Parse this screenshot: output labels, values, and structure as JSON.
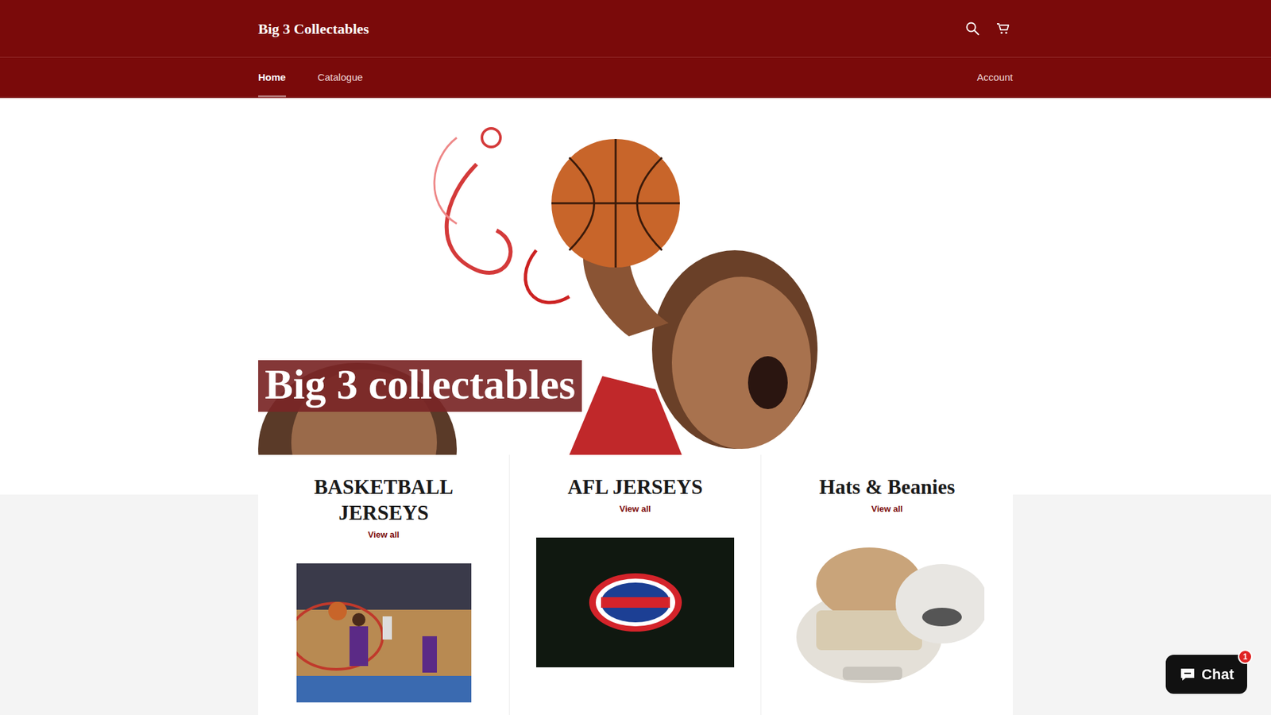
{
  "store": {
    "name": "Big 3 Collectables"
  },
  "nav": [
    {
      "label": "Home",
      "selected": true
    },
    {
      "label": "Catalogue",
      "selected": false
    }
  ],
  "account": "Account",
  "hero": {
    "title": "Big 3 collectables"
  },
  "collections": [
    {
      "title": "BASKETBALL JERSEYS",
      "link": "View all",
      "kind": "court"
    },
    {
      "title": "AFL JERSEYS",
      "link": "View all",
      "kind": "logo"
    },
    {
      "title": "Hats & Beanies",
      "link": "View all",
      "kind": "hats"
    }
  ],
  "chat": {
    "label": "Chat",
    "badge": "1"
  }
}
